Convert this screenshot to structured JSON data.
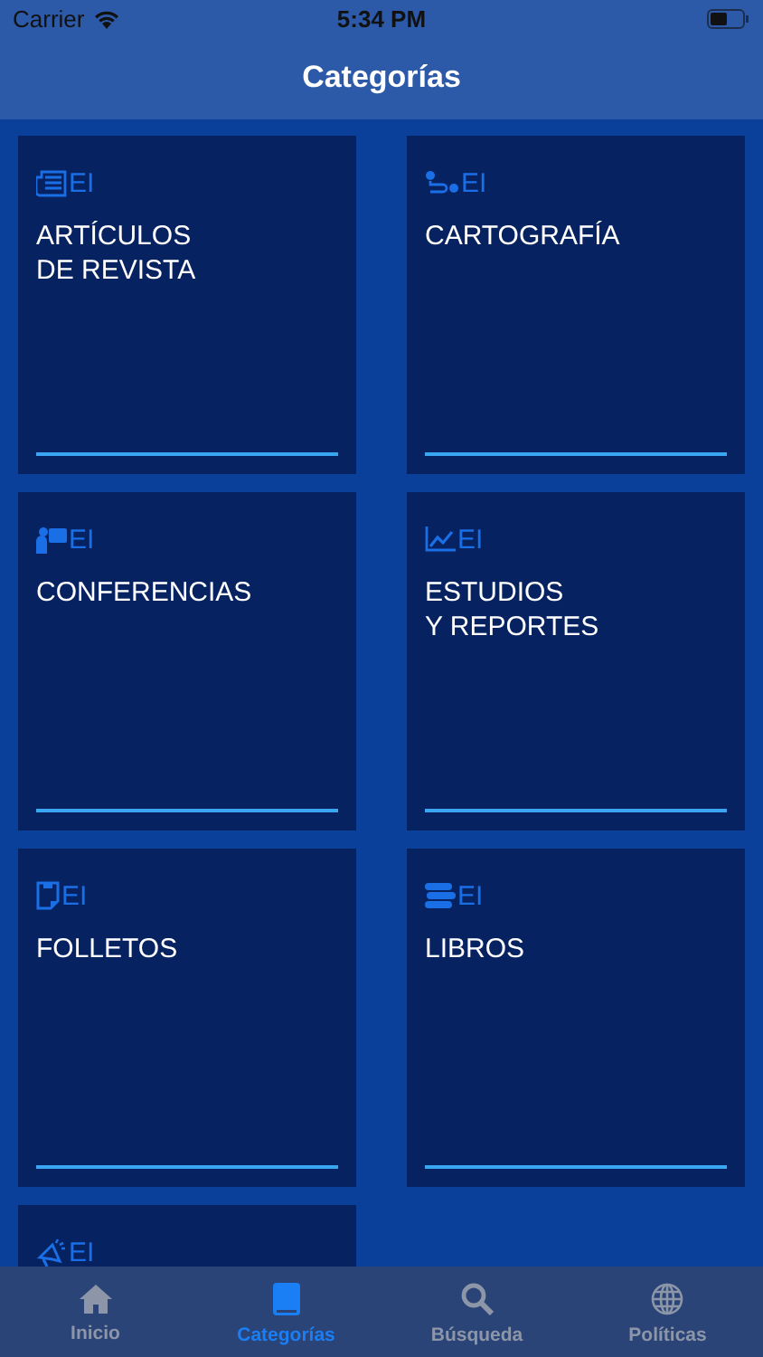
{
  "status_bar": {
    "carrier": "Carrier",
    "time": "5:34 PM"
  },
  "nav": {
    "title": "Categorías"
  },
  "categories": [
    {
      "icon_label": "EI",
      "title": "ARTÍCULOS\nDE REVISTA"
    },
    {
      "icon_label": "EI",
      "title": "CARTOGRAFÍA"
    },
    {
      "icon_label": "EI",
      "title": "CONFERENCIAS"
    },
    {
      "icon_label": "EI",
      "title": "ESTUDIOS\nY REPORTES"
    },
    {
      "icon_label": "EI",
      "title": "FOLLETOS"
    },
    {
      "icon_label": "EI",
      "title": "LIBROS"
    },
    {
      "icon_label": "EI"
    }
  ],
  "tabs": [
    {
      "label": "Inicio",
      "selected": false
    },
    {
      "label": "Categorías",
      "selected": true
    },
    {
      "label": "Búsqueda",
      "selected": false
    },
    {
      "label": "Políticas",
      "selected": false
    }
  ]
}
